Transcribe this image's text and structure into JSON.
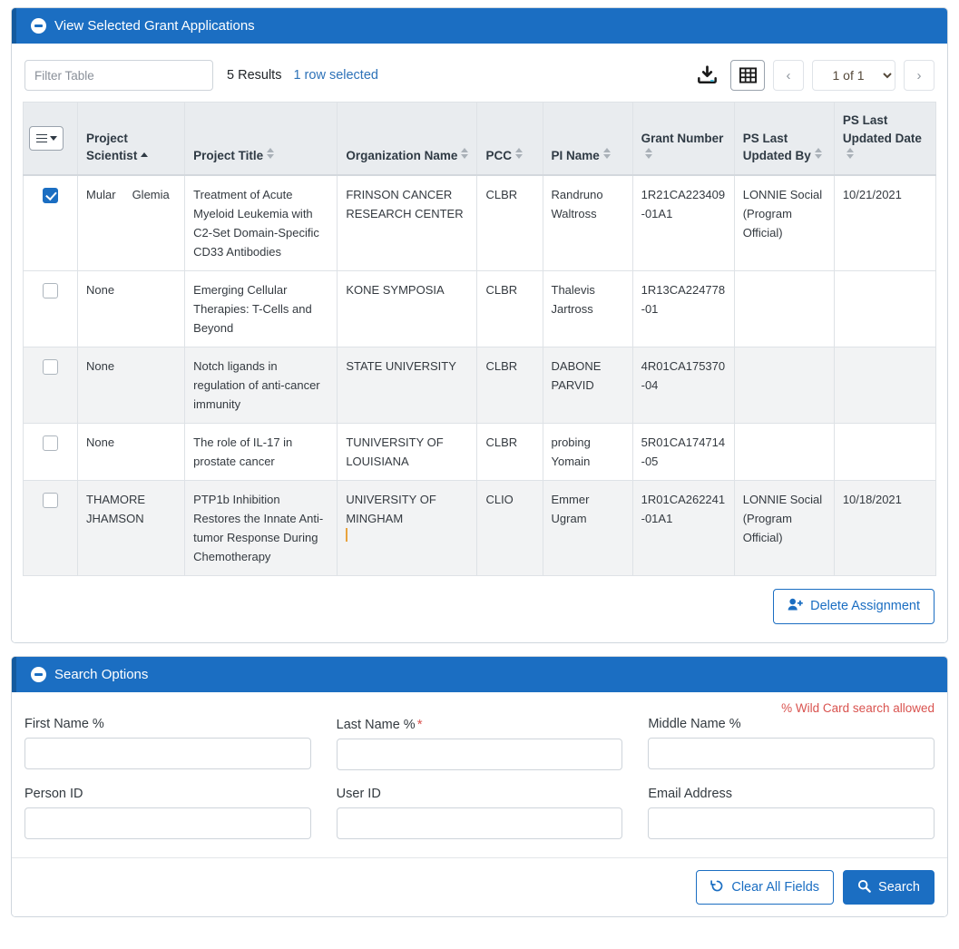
{
  "grant_panel": {
    "header_title": "View Selected Grant Applications",
    "collapse_icon": "minus-circle-icon",
    "toolbar": {
      "filter_placeholder": "Filter Table",
      "filter_value": "",
      "results_count": "5 Results",
      "rows_selected": "1 row selected",
      "download_icon": "download-icon",
      "grid_icon": "grid-view-icon",
      "prev_label": "‹",
      "next_label": "›",
      "page_value": "1 of 1",
      "page_options": [
        "1 of 1"
      ]
    },
    "columns": [
      {
        "label": "Project Scientist",
        "sort": "asc"
      },
      {
        "label": "Project Title",
        "sort": "none"
      },
      {
        "label": "Organization Name",
        "sort": "none"
      },
      {
        "label": "PCC",
        "sort": "none"
      },
      {
        "label": "PI Name",
        "sort": "none"
      },
      {
        "label": "Grant Number",
        "sort": "none"
      },
      {
        "label": "PS Last Updated By",
        "sort": "none"
      },
      {
        "label": "PS Last Updated Date",
        "sort": "none"
      }
    ],
    "rows": [
      {
        "selected": true,
        "project_scientist_last": "Mular",
        "project_scientist_first": "Glemia",
        "project_title": "Treatment of Acute Myeloid Leukemia with C2-Set Domain-Specific CD33 Antibodies",
        "organization_name": "FRINSON CANCER RESEARCH CENTER",
        "pcc": "CLBR",
        "pi_name": "Randruno Waltross",
        "grant_number": "1R21CA223409-01A1",
        "ps_last_updated_by": "LONNIE Social (Program Official)",
        "ps_last_updated_date": "10/21/2021"
      },
      {
        "selected": false,
        "project_scientist_last": "None",
        "project_scientist_first": "",
        "project_title": "Emerging Cellular Therapies: T-Cells and Beyond",
        "organization_name": "KONE SYMPOSIA",
        "pcc": "CLBR",
        "pi_name": "Thalevis Jartross",
        "grant_number": "1R13CA224778-01",
        "ps_last_updated_by": "",
        "ps_last_updated_date": ""
      },
      {
        "selected": false,
        "project_scientist_last": "None",
        "project_scientist_first": "",
        "project_title": "Notch ligands in regulation of anti-cancer immunity",
        "organization_name": "STATE UNIVERSITY",
        "pcc": "CLBR",
        "pi_name": "DABONE PARVID",
        "grant_number": "4R01CA175370-04",
        "ps_last_updated_by": "",
        "ps_last_updated_date": ""
      },
      {
        "selected": false,
        "project_scientist_last": "None",
        "project_scientist_first": "",
        "project_title": "The role of IL-17 in prostate cancer",
        "organization_name": "TUNIVERSITY OF LOUISIANA",
        "pcc": "CLBR",
        "pi_name": "probing Yomain",
        "grant_number": "5R01CA174714-05",
        "ps_last_updated_by": "",
        "ps_last_updated_date": ""
      },
      {
        "selected": false,
        "project_scientist_last": "THAMORE",
        "project_scientist_first": "JHAMSON",
        "project_title": "PTP1b Inhibition Restores the Innate Anti-tumor Response During Chemotherapy",
        "organization_name": "UNIVERSITY OF MINGHAM",
        "pcc": "CLIO",
        "pi_name": "Emmer Ugram",
        "grant_number": "1R01CA262241-01A1",
        "ps_last_updated_by": "LONNIE Social (Program Official)",
        "ps_last_updated_date": "10/18/2021"
      }
    ],
    "delete_button": {
      "label": "Delete Assignment",
      "icon": "user-minus-icon"
    }
  },
  "search_panel": {
    "header_title": "Search Options",
    "collapse_icon": "minus-circle-icon",
    "wildcard_note": "% Wild Card search allowed",
    "fields": [
      {
        "label": "First Name %",
        "value": "",
        "required": false
      },
      {
        "label": "Last Name %",
        "value": "",
        "required": true
      },
      {
        "label": "Middle Name %",
        "value": "",
        "required": false
      },
      {
        "label": "Person ID",
        "value": "",
        "required": false
      },
      {
        "label": "User ID",
        "value": "",
        "required": false
      },
      {
        "label": "Email Address",
        "value": "",
        "required": false
      }
    ],
    "clear_button": {
      "label": "Clear All Fields",
      "icon": "undo-icon"
    },
    "search_button": {
      "label": "Search",
      "icon": "search-icon"
    }
  },
  "colors": {
    "brand_blue": "#1b6ec2",
    "header_gray": "#e9ecef",
    "link_blue": "#2d72b8",
    "required_red": "#d9534f",
    "row_alt_gray": "#f2f3f4"
  }
}
